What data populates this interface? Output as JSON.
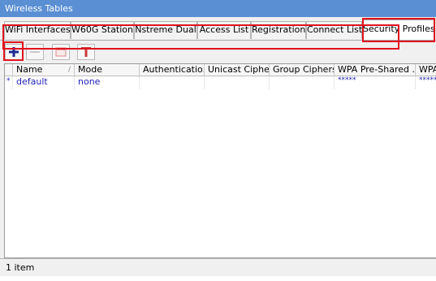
{
  "window": {
    "title": "Wireless Tables"
  },
  "tabs": [
    {
      "label": "WiFi Interfaces"
    },
    {
      "label": "W60G Station"
    },
    {
      "label": "Nstreme Dual"
    },
    {
      "label": "Access List"
    },
    {
      "label": "Registration"
    },
    {
      "label": "Connect List"
    },
    {
      "label": "Security Profiles",
      "active": true
    }
  ],
  "toolbar": {
    "buttons": [
      {
        "icon": "plus-icon"
      },
      {
        "icon": "minus-icon"
      },
      {
        "icon": "comment-icon"
      },
      {
        "icon": "filter-icon"
      }
    ]
  },
  "table": {
    "columns": [
      "Name",
      "Mode",
      "Authenticatio...",
      "Unicast Ciphers",
      "Group Ciphers",
      "WPA Pre-Shared ...",
      "WPA"
    ],
    "rows": [
      {
        "marker": "*",
        "name": "default",
        "mode": "none",
        "authentication": "",
        "unicast_ciphers": "",
        "group_ciphers": "",
        "wpa_psk": "*****",
        "wpa2_psk": "*****"
      }
    ]
  },
  "status": {
    "count": "1 item"
  },
  "colors": {
    "titlebar": "#5a8fd3",
    "highlight": "#e0131d",
    "row_text": "#1f1fb8"
  }
}
